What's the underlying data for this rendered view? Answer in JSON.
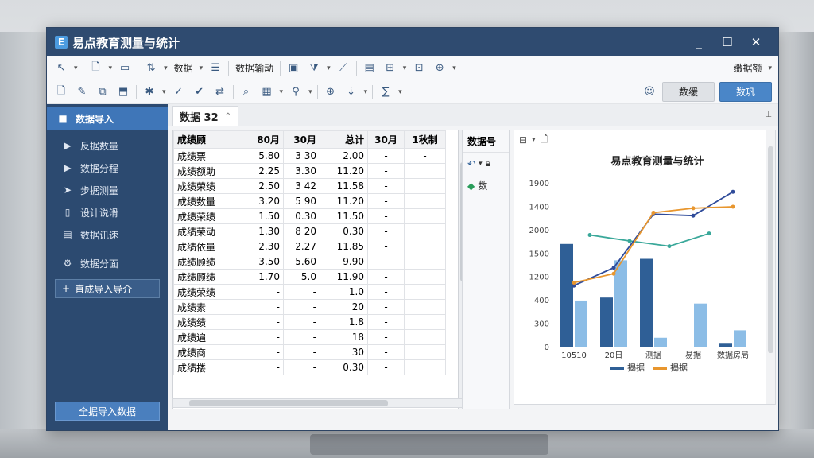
{
  "app": {
    "title": "易点教育测量与统计",
    "logo": "E"
  },
  "window_controls": {
    "minimize": "_",
    "maximize": "☐",
    "close": "✕"
  },
  "toolbar": {
    "row1_text": [
      "数据",
      "数据输动"
    ],
    "row1_right": "缴据额",
    "row2_buttons": {
      "gray": "数缓",
      "blue": "数巩"
    }
  },
  "sidebar": {
    "items": [
      {
        "label": "数据导入",
        "icon": "grid-icon",
        "glyph": "■"
      },
      {
        "label": "反据数量",
        "icon": "play-icon",
        "glyph": "▶"
      },
      {
        "label": "数据分程",
        "icon": "play-icon",
        "glyph": "▶"
      },
      {
        "label": "步据测量",
        "icon": "arrow-icon",
        "glyph": "➤"
      },
      {
        "label": "设计说滑",
        "icon": "phone-icon",
        "glyph": "▯"
      },
      {
        "label": "数据讯速",
        "icon": "database-icon",
        "glyph": "▤"
      },
      {
        "label": "数据分面",
        "icon": "gear-icon",
        "glyph": "⚙"
      }
    ],
    "add_button": "直成导入导介",
    "bottom_button": "全据导入数据"
  },
  "tab": {
    "label": "数据 32"
  },
  "grid": {
    "headers": [
      "成绩顾",
      "80月",
      "30月",
      "总计",
      "30月",
      "1秋制"
    ],
    "rows": [
      [
        "成绩票",
        "5.80",
        "3 30",
        "2.00",
        "-",
        "-"
      ],
      [
        "成绩额助",
        "2.25",
        "3.30",
        "11.20",
        "-",
        ""
      ],
      [
        "成绩荣绩",
        "2.50",
        "3 42",
        "11.58",
        "-",
        ""
      ],
      [
        "成绩数量",
        "3.20",
        "5 90",
        "11.20",
        "-",
        ""
      ],
      [
        "成绩荣绩",
        "1.50",
        "0.30",
        "11.50",
        "-",
        ""
      ],
      [
        "成绩荣动",
        "1.30",
        "8 20",
        "0.30",
        "-",
        ""
      ],
      [
        "成绩依量",
        "2.30",
        "2.27",
        "11.85",
        "-",
        ""
      ],
      [
        "成绩顾绩",
        "3.50",
        "5.60",
        "9.90",
        "",
        ""
      ],
      [
        "成绩顾绩",
        "1.70",
        "5.0",
        "11.90",
        "-",
        ""
      ],
      [
        "成绩荣绩",
        "-",
        "-",
        "1.0",
        "-",
        ""
      ],
      [
        "成绩素",
        "-",
        "-",
        "20",
        "-",
        ""
      ],
      [
        "成绩绩",
        "-",
        "-",
        "1.8",
        "-",
        ""
      ],
      [
        "成绩遍",
        "-",
        "-",
        "18",
        "-",
        ""
      ],
      [
        "成绩商",
        "-",
        "-",
        "30",
        "-",
        ""
      ],
      [
        "成绩搂",
        "-",
        "-",
        "0.30",
        "-",
        ""
      ]
    ]
  },
  "mini_panel": {
    "title": "数据号",
    "item": "数"
  },
  "chart_data": {
    "type": "bar",
    "title": "易点教育测量与统计",
    "categories": [
      "10510",
      "20日",
      "测据",
      "易据",
      "数据房局"
    ],
    "y_ticks": [
      "0",
      "300",
      "400",
      "1200",
      "1500",
      "2000",
      "1400",
      "1900"
    ],
    "ylim": [
      0,
      2200
    ],
    "bars_dark": [
      1380,
      660,
      1180,
      0,
      40
    ],
    "bars_light": [
      620,
      1160,
      120,
      580,
      220
    ],
    "line_dark": [
      820,
      1060,
      1780,
      1760,
      2080
    ],
    "line_orange": [
      860,
      980,
      1800,
      1860,
      1880
    ],
    "line_teal": [
      1500,
      1420,
      1350,
      1520
    ],
    "legend": [
      "揭据",
      "揭据"
    ],
    "colors": {
      "bar_dark": "#2f5f96",
      "bar_light": "#8cbde6",
      "line_dark": "#2f4b9a",
      "line_orange": "#e8962e",
      "line_teal": "#3aa89a"
    }
  }
}
